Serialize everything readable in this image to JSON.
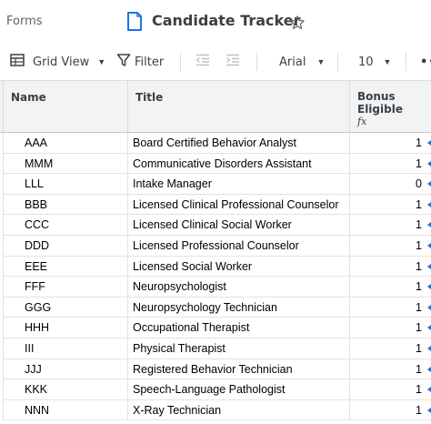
{
  "header": {
    "forms_label": "Forms",
    "title": "Candidate Tracker",
    "doc_icon": "sheet-document-icon",
    "star_icon": "star-outline-icon"
  },
  "toolbar": {
    "view_label": "Grid View",
    "filter_label": "Filter",
    "font_label": "Arial",
    "size_label": "10",
    "more_label": "•••"
  },
  "grid": {
    "columns": {
      "name": "Name",
      "title": "Title",
      "bonus_line1": "Bonus",
      "bonus_line2": "Eligible",
      "bonus_fx": "fx"
    },
    "rows": [
      {
        "name": "AAA",
        "title": "Board Certified Behavior Analyst",
        "bonus": "1"
      },
      {
        "name": "MMM",
        "title": "Communicative Disorders Assistant",
        "bonus": "1"
      },
      {
        "name": "LLL",
        "title": "Intake Manager",
        "bonus": "0"
      },
      {
        "name": "BBB",
        "title": "Licensed Clinical Professional Counselor",
        "bonus": "1"
      },
      {
        "name": "CCC",
        "title": "Licensed Clinical Social Worker",
        "bonus": "1"
      },
      {
        "name": "DDD",
        "title": "Licensed Professional Counselor",
        "bonus": "1"
      },
      {
        "name": "EEE",
        "title": "Licensed Social Worker",
        "bonus": "1"
      },
      {
        "name": "FFF",
        "title": "Neuropsychologist",
        "bonus": "1"
      },
      {
        "name": "GGG",
        "title": "Neuropsychology Technician",
        "bonus": "1"
      },
      {
        "name": "HHH",
        "title": "Occupational Therapist",
        "bonus": "1"
      },
      {
        "name": "III",
        "title": "Physical Therapist",
        "bonus": "1"
      },
      {
        "name": "JJJ",
        "title": "Registered Behavior Technician",
        "bonus": "1"
      },
      {
        "name": "KKK",
        "title": "Speech-Language Pathologist",
        "bonus": "1"
      },
      {
        "name": "NNN",
        "title": "X-Ray Technician",
        "bonus": "1"
      }
    ]
  },
  "colors": {
    "accent": "#1a73e8",
    "header_bg": "#f1f3f4"
  }
}
